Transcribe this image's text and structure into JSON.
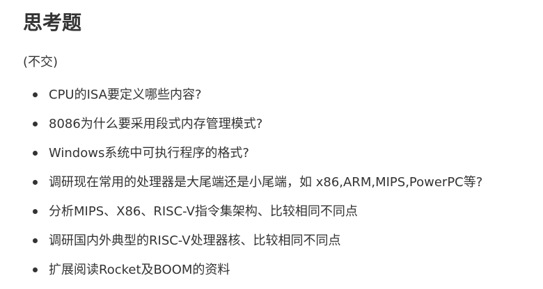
{
  "title": "思考题",
  "note": "(不交)",
  "questions": [
    "CPU的ISA要定义哪些内容?",
    "8086为什么要采用段式内存管理模式?",
    "Windows系统中可执行程序的格式?",
    "调研现在常用的处理器是大尾端还是小尾端，如 x86,ARM,MIPS,PowerPC等?",
    "分析MIPS、X86、RISC-V指令集架构、比较相同不同点",
    "调研国内外典型的RISC-V处理器核、比较相同不同点",
    "扩展阅读Rocket及BOOM的资料"
  ]
}
